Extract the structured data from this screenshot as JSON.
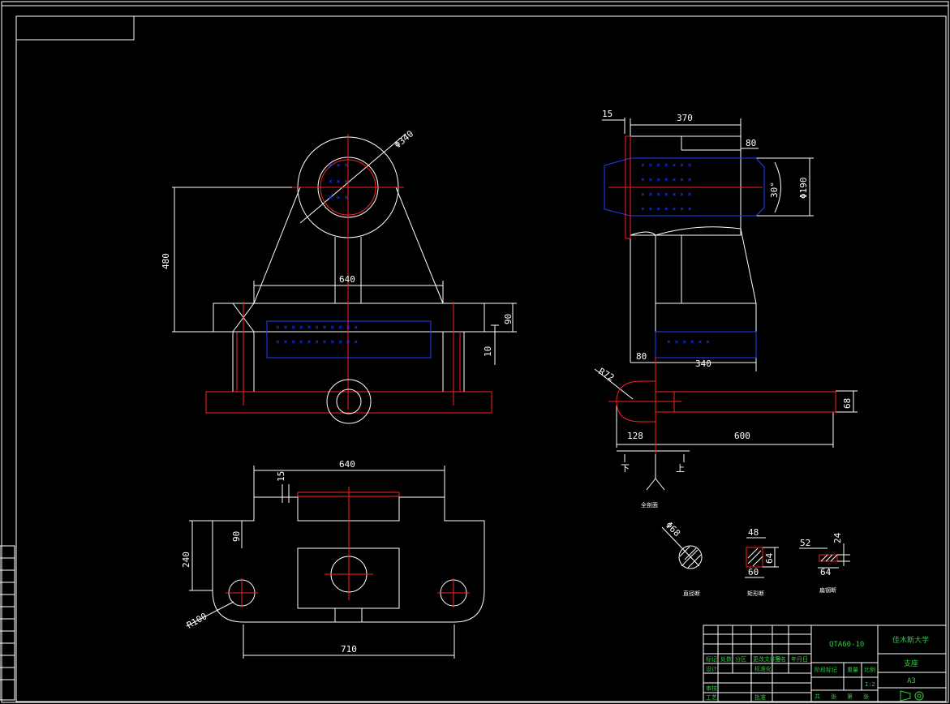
{
  "drawing": {
    "dims": {
      "d340": "Φ340",
      "h480": "480",
      "w640_front": "640",
      "h90_front": "90",
      "h10_front": "10",
      "w640_plan": "640",
      "h15_plan": "15",
      "h90_plan": "90",
      "h240_plan": "240",
      "r100": "R100",
      "w710": "710",
      "w15_side": "15",
      "w370": "370",
      "w80_top": "80",
      "a30": "30°",
      "d190": "Φ190",
      "w80_left": "80",
      "w340": "340",
      "r72": "R72",
      "h68": "68",
      "w128": "128",
      "w600": "600",
      "d68": "Φ68",
      "s48": "48",
      "s64a": "64",
      "s60": "60",
      "s52": "52",
      "s24": "24",
      "s64b": "64",
      "lower_mark": "下",
      "upper_mark": "上"
    },
    "section_labels": [
      "全剖面",
      "直径断",
      "矩形断",
      "扁钢断"
    ],
    "title_block": {
      "drawing_no": "QTA60-10",
      "school": "佳木斯大学",
      "part_name": "支座",
      "sheet_size": "A3",
      "scale": "1:2",
      "small_cells": [
        "标记",
        "处数",
        "分区",
        "更改文件号",
        "签名",
        "年月日",
        "设计",
        "标准化",
        "审核",
        "工艺",
        "批准",
        "阶段标记",
        "重量",
        "比例",
        "共",
        "张",
        "第",
        "张"
      ]
    },
    "colors": {
      "outline": "#ffffff",
      "centerline": "#ff2020",
      "hatch": "#2040ff",
      "title_text": "#2ecc40"
    }
  }
}
